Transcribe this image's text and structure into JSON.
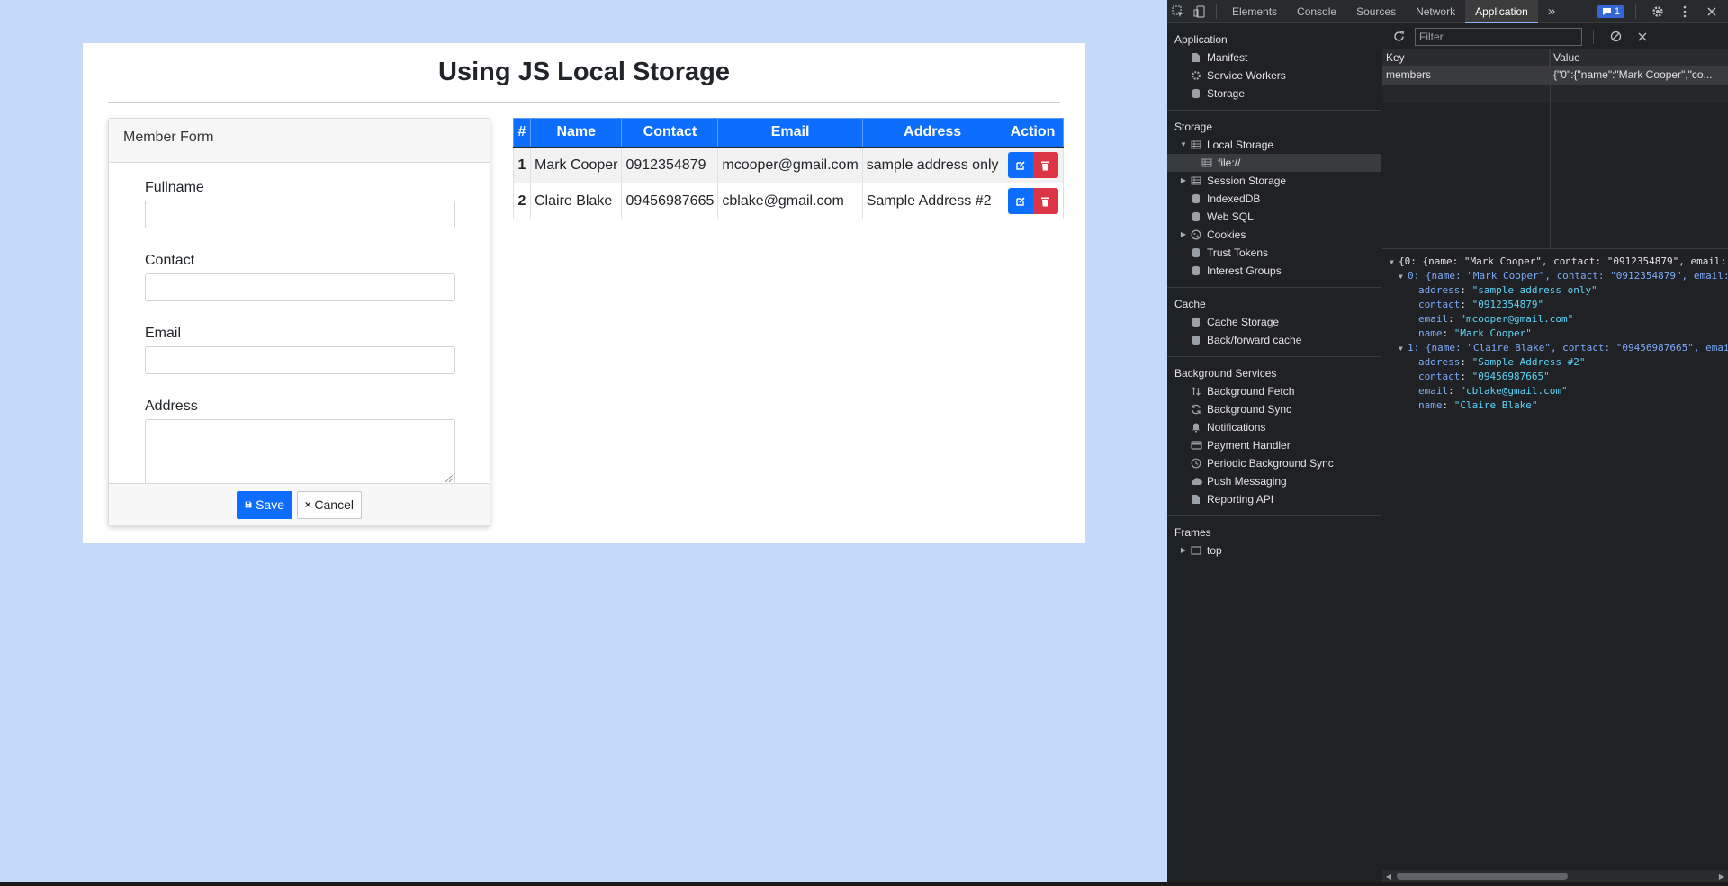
{
  "page": {
    "title": "Using JS Local Storage",
    "form": {
      "header": "Member Form",
      "labels": {
        "fullname": "Fullname",
        "contact": "Contact",
        "email": "Email",
        "address": "Address"
      },
      "save_label": "Save",
      "cancel_label": "Cancel"
    },
    "table": {
      "headers": [
        "#",
        "Name",
        "Contact",
        "Email",
        "Address",
        "Action"
      ],
      "rows": [
        {
          "num": "1",
          "name": "Mark Cooper",
          "contact": "0912354879",
          "email": "mcooper@gmail.com",
          "address": "sample address only"
        },
        {
          "num": "2",
          "name": "Claire Blake",
          "contact": "09456987665",
          "email": "cblake@gmail.com",
          "address": "Sample Address #2"
        }
      ]
    },
    "colors": {
      "primary": "#0d6efd",
      "danger": "#dc3545",
      "background": "#c5daf8"
    }
  },
  "devtools": {
    "tabs": [
      "Elements",
      "Console",
      "Sources",
      "Network",
      "Application"
    ],
    "active_tab": "Application",
    "more_tabs": "»",
    "issues_count": "1",
    "sidebar": {
      "application": {
        "title": "Application",
        "items": [
          "Manifest",
          "Service Workers",
          "Storage"
        ]
      },
      "storage": {
        "title": "Storage",
        "local_storage": "Local Storage",
        "local_storage_child": "file://",
        "items": [
          "Session Storage",
          "IndexedDB",
          "Web SQL",
          "Cookies",
          "Trust Tokens",
          "Interest Groups"
        ]
      },
      "cache": {
        "title": "Cache",
        "items": [
          "Cache Storage",
          "Back/forward cache"
        ]
      },
      "background": {
        "title": "Background Services",
        "items": [
          "Background Fetch",
          "Background Sync",
          "Notifications",
          "Payment Handler",
          "Periodic Background Sync",
          "Push Messaging",
          "Reporting API"
        ]
      },
      "frames": {
        "title": "Frames",
        "top": "top"
      }
    },
    "filter_placeholder": "Filter",
    "kv": {
      "headers": {
        "key": "Key",
        "value": "Value"
      },
      "row": {
        "key": "members",
        "value": "{\"0\":{\"name\":\"Mark Cooper\",\"co..."
      }
    },
    "preview": {
      "root": "{0: {name: \"Mark Cooper\", contact: \"0912354879\", email:",
      "item0_summary": "0: {name: \"Mark Cooper\", contact: \"0912354879\", email:",
      "item0": {
        "address": "\"sample address only\"",
        "contact": "\"0912354879\"",
        "email": "\"mcooper@gmail.com\"",
        "name": "\"Mark Cooper\""
      },
      "item1_summary": "1: {name: \"Claire Blake\", contact: \"09456987665\", emai",
      "item1": {
        "address": "\"Sample Address #2\"",
        "contact": "\"09456987665\"",
        "email": "\"cblake@gmail.com\"",
        "name": "\"Claire Blake\""
      },
      "keys": {
        "address": "address",
        "contact": "contact",
        "email": "email",
        "name": "name"
      }
    }
  }
}
